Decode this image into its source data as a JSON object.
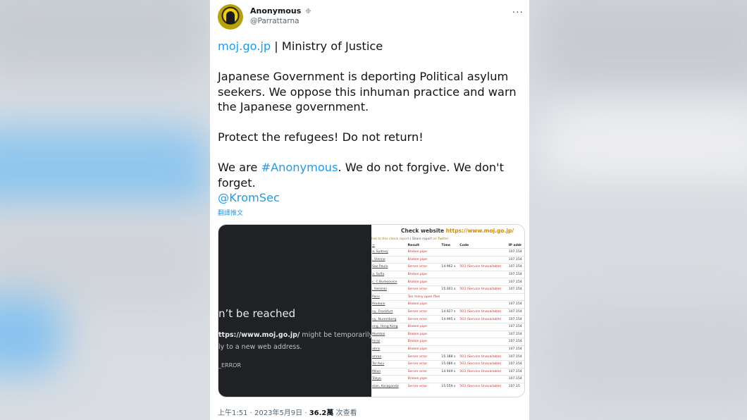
{
  "tweet": {
    "name": "Anonymous",
    "verified_mark": "❉",
    "handle": "@Parrattarna",
    "more": "···",
    "text": {
      "line1_link": "moj.go.jp",
      "line1_rest": " | Ministry of Justice",
      "para2": "Japanese Government is deporting Political asylum seekers. We oppose this inhuman practice and warn the Japanese government.",
      "para3": "Protect the refugees! Do not return!",
      "para4_a": "We are ",
      "para4_hashtag": "#Anonymous",
      "para4_b": ". We do not forgive. We don't forget.",
      "mention": "@KromSec"
    },
    "translate": "翻譯推文",
    "footer": {
      "time_date": "上午1:51 · 2023年5月9日 · ",
      "views": "36.2萬",
      "views_label": " 次查看"
    }
  },
  "media": {
    "error_title": "n’t be reached",
    "error_url": "ttps://www.moj.go.jp/",
    "error_url_suffix": " might be temporarily",
    "error_line2": "ly to a new web address.",
    "error_code": "_ERROR",
    "check": {
      "title": "Check website ",
      "url": "https://www.moj.go.jp/",
      "sub_link": "link to this check report",
      "sub_sep": " | Share report ",
      "sub_twitter": "on Twitter",
      "headers": [
        "~",
        "Result",
        "Time",
        "Code",
        "IP addr"
      ],
      "rows": [
        {
          "loc": "a, Sydney",
          "result": "Broken pipe",
          "time": "",
          "code": "",
          "ip": "107.154"
        },
        {
          "loc": ", Vienna",
          "result": "Broken pipe",
          "time": "",
          "code": "",
          "ip": "107.154"
        },
        {
          "loc": "Sao Paulo",
          "result": "Server error",
          "time": "14.962 s",
          "code": "503 (Service Unavailable)",
          "ip": "107.154"
        },
        {
          "loc": "a, Sofia",
          "result": "Broken pipe",
          "time": "",
          "code": "",
          "ip": "107.154"
        },
        {
          "loc": "c, C.Budejovice",
          "result": "Broken pipe",
          "time": "",
          "code": "",
          "ip": "107.154"
        },
        {
          "loc": ", Helsinki",
          "result": "Server error",
          "time": "15.001 s",
          "code": "503 (Service Unavailable)",
          "ip": "107.154"
        },
        {
          "loc": "Paris",
          "result": "Too many open files",
          "time": "",
          "code": "",
          "ip": ""
        },
        {
          "loc": "Roubaix",
          "result": "Broken pipe",
          "time": "",
          "code": "",
          "ip": "107.154"
        },
        {
          "loc": "ny, Frankfurt",
          "result": "Server error",
          "time": "14.927 s",
          "code": "503 (Service Unavailable)",
          "ip": "107.154"
        },
        {
          "loc": "ny, Nuremberg",
          "result": "Server error",
          "time": "14.995 s",
          "code": "503 (Service Unavailable)",
          "ip": "107.154"
        },
        {
          "loc": "ong, Hong Kong",
          "result": "Broken pipe",
          "time": "",
          "code": "",
          "ip": "107.154"
        },
        {
          "loc": "Mumbai",
          "result": "Broken pipe",
          "time": "",
          "code": "",
          "ip": "107.154"
        },
        {
          "loc": "hiraz",
          "result": "Broken pipe",
          "time": "",
          "code": "",
          "ip": "107.154"
        },
        {
          "loc": "abriz",
          "result": "Broken pipe",
          "time": "",
          "code": "",
          "ip": "107.154"
        },
        {
          "loc": "ehran",
          "result": "Server error",
          "time": "15.188 s",
          "code": "503 (Service Unavailable)",
          "ip": "107.154"
        },
        {
          "loc": "Tel Aviv",
          "result": "Server error",
          "time": "15.086 s",
          "code": "503 (Service Unavailable)",
          "ip": "107.154"
        },
        {
          "loc": "Milan",
          "result": "Server error",
          "time": "14.949 s",
          "code": "503 (Service Unavailable)",
          "ip": "107.154"
        },
        {
          "loc": "Tokyo",
          "result": "Broken pipe",
          "time": "",
          "code": "",
          "ip": "107.154"
        },
        {
          "loc": "stan, Karaganda",
          "result": "Server error",
          "time": "15.559 s",
          "code": "503 (Service Unavailable)",
          "ip": "107.15"
        }
      ]
    }
  },
  "colors": {
    "link": "#1d9bf0",
    "text": "#0f1419",
    "secondary": "#536471",
    "error_red": "#d32f2f"
  }
}
